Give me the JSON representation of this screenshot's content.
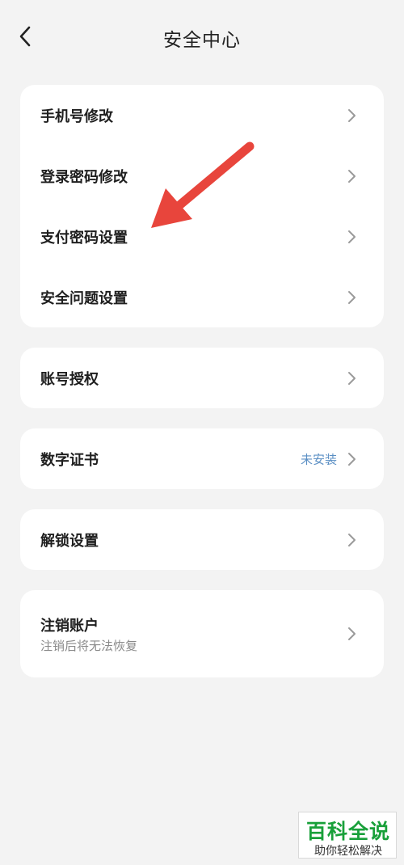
{
  "header": {
    "title": "安全中心"
  },
  "groups": {
    "security": {
      "items": [
        {
          "label": "手机号修改"
        },
        {
          "label": "登录密码修改"
        },
        {
          "label": "支付密码设置"
        },
        {
          "label": "安全问题设置"
        }
      ]
    },
    "account_auth": {
      "label": "账号授权"
    },
    "digital_cert": {
      "label": "数字证书",
      "status": "未安装"
    },
    "unlock": {
      "label": "解锁设置"
    },
    "cancel_account": {
      "label": "注销账户",
      "sublabel": "注销后将无法恢复"
    }
  },
  "watermark": {
    "title": "百科全说",
    "subtitle": "助你轻松解决"
  },
  "colors": {
    "background": "#f3f3f3",
    "card": "#ffffff",
    "status_text": "#5b8fc4",
    "annotation_arrow": "#e8453c",
    "watermark_green": "#19a03a"
  },
  "icons": {
    "back": "chevron-left-icon",
    "row_arrow": "chevron-right-icon"
  }
}
